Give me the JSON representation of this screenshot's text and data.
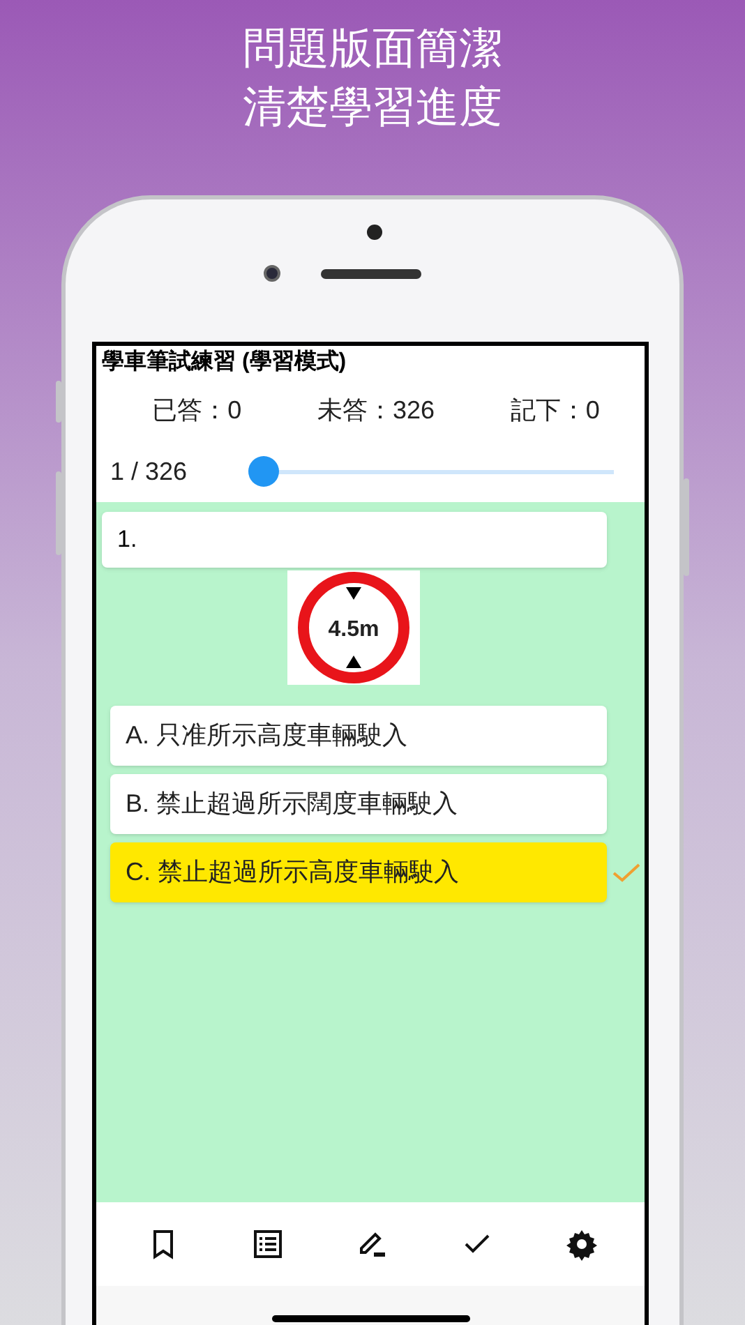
{
  "headline": [
    "問題版面簡潔",
    "清楚學習進度"
  ],
  "app": {
    "title": "學車筆試練習 (學習模式)",
    "stats": [
      "已答：0",
      "未答：326",
      "記下：0"
    ],
    "progress": {
      "label": "1 / 326",
      "level": 0
    },
    "question": {
      "number": "1.",
      "sign_text": "4.5m",
      "options": [
        {
          "label": "A. 只准所示高度車輛駛入",
          "selected": false,
          "correct": false
        },
        {
          "label": "B. 禁止超過所示闊度車輛駛入",
          "selected": false,
          "correct": false
        },
        {
          "label": "C. 禁止超過所示高度車輛駛入",
          "selected": true,
          "correct": true
        }
      ]
    },
    "toolbar": [
      {
        "kind": "bookmark"
      },
      {
        "kind": "list"
      },
      {
        "kind": "pen"
      },
      {
        "kind": "check"
      },
      {
        "kind": "settings"
      }
    ]
  }
}
